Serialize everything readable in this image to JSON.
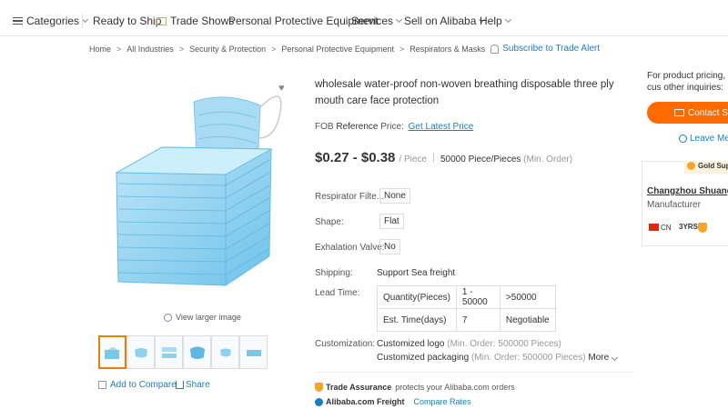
{
  "nav": {
    "categories": "Categories",
    "ready_to_ship": "Ready to Ship",
    "trade_shows": "Trade Shows",
    "ppe": "Personal Protective Equipment",
    "services": "Services",
    "sell": "Sell on Alibaba",
    "help": "Help"
  },
  "breadcrumb": {
    "items": [
      "Home",
      "All Industries",
      "Security & Protection",
      "Personal Protective Equipment",
      "Respirators & Masks"
    ],
    "subscribe": "Subscribe to Trade Alert"
  },
  "gallery": {
    "view_larger": "View larger image",
    "add_compare": "Add to Compare",
    "share": "Share"
  },
  "product": {
    "title": "wholesale water-proof non-woven breathing disposable three ply mouth care face protection",
    "fob_prefix": "FOB",
    "fob_bold": "Reference",
    "fob_suffix": "Price:",
    "latest_price": "Get Latest Price",
    "price": "$0.27 - $0.38",
    "price_unit": "/ Piece",
    "moq": "50000 Piece/Pieces",
    "moq_note": "(Min. Order)"
  },
  "attributes": {
    "respirator_label": "Respirator Filte...",
    "respirator_value": "None",
    "shape_label": "Shape:",
    "shape_value": "Flat",
    "valve_label": "Exhalation Valve:",
    "valve_value": "No",
    "shipping_label": "Shipping:",
    "shipping_value": "Support Sea freight",
    "lead_label": "Lead Time:"
  },
  "lead_table": {
    "rows": [
      [
        "Quantity(Pieces)",
        "1 - 50000",
        ">50000"
      ],
      [
        "Est. Time(days)",
        "7",
        "Negotiable"
      ]
    ]
  },
  "customization": {
    "label": "Customization:",
    "logo": "Customized logo",
    "logo_note": "(Min. Order: 500000 Pieces)",
    "packaging": "Customized packaging",
    "packaging_note": "(Min. Order: 500000 Pieces)",
    "more": "More"
  },
  "assurance": {
    "trade_title": "Trade Assurance",
    "trade_text": "protects your Alibaba.com orders",
    "freight_title": "Alibaba.com Freight",
    "freight_link": "Compare Rates"
  },
  "sidebar": {
    "inquiry_text": "For product pricing, cus other inquiries:",
    "contact": "Contact Su",
    "leave": "Leave Mes",
    "gold": "Gold Supp",
    "supplier_name": "Changzhou Shuangma",
    "supplier_type": "Manufacturer",
    "country": "CN",
    "years": "3YRS"
  },
  "colors": {
    "accent": "#ff6a00",
    "link": "#1a7ec2",
    "mask_blue": "#8fd0ef"
  }
}
